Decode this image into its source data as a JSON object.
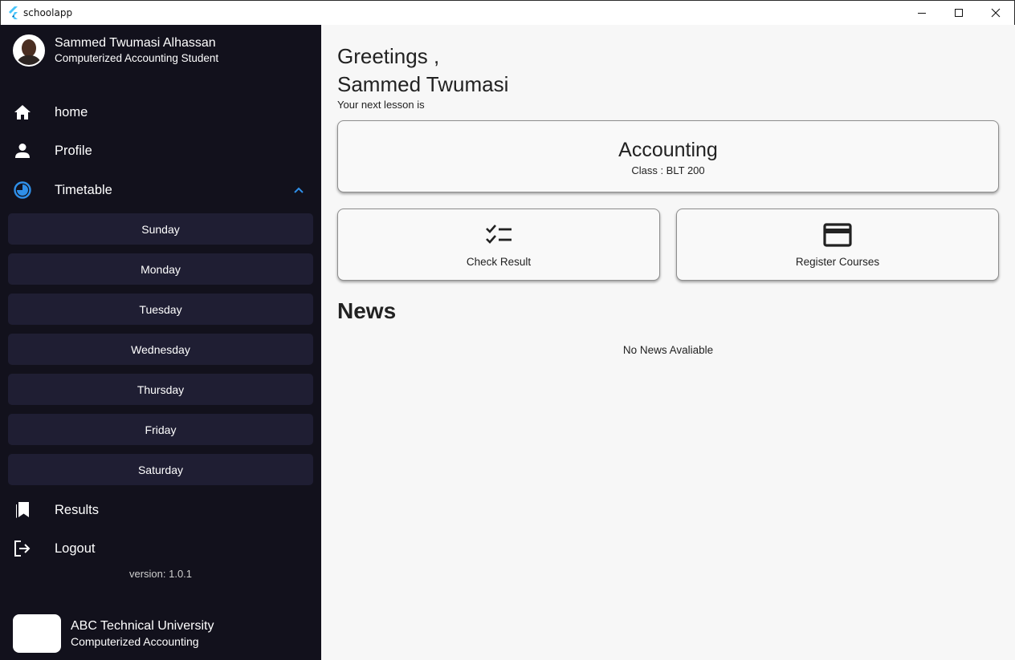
{
  "window": {
    "title": "schoolapp",
    "controls": [
      "minimize-icon",
      "maximize-icon",
      "close-icon"
    ]
  },
  "sidebar": {
    "profile": {
      "name": "Sammed Twumasi Alhassan",
      "role": "Computerized Accounting Student"
    },
    "nav": {
      "home": "home",
      "profile": "Profile",
      "timetable": "Timetable",
      "results": "Results",
      "logout": "Logout"
    },
    "days": [
      "Sunday",
      "Monday",
      "Tuesday",
      "Wednesday",
      "Thursday",
      "Friday",
      "Saturday"
    ],
    "version": "version: 1.0.1",
    "institution": {
      "name": "ABC Technical University",
      "department": "Computerized Accounting"
    },
    "accent_color": "#2f8fe8"
  },
  "main": {
    "greeting_line1": "Greetings ,",
    "greeting_line2": "Sammed Twumasi",
    "next_lesson_label": "Your next lesson is",
    "lesson": {
      "title": "Accounting",
      "class": "Class : BLT 200"
    },
    "actions": {
      "check_result": "Check Result",
      "register_courses": "Register Courses"
    },
    "news": {
      "title": "News",
      "empty": "No News Avaliable"
    }
  }
}
